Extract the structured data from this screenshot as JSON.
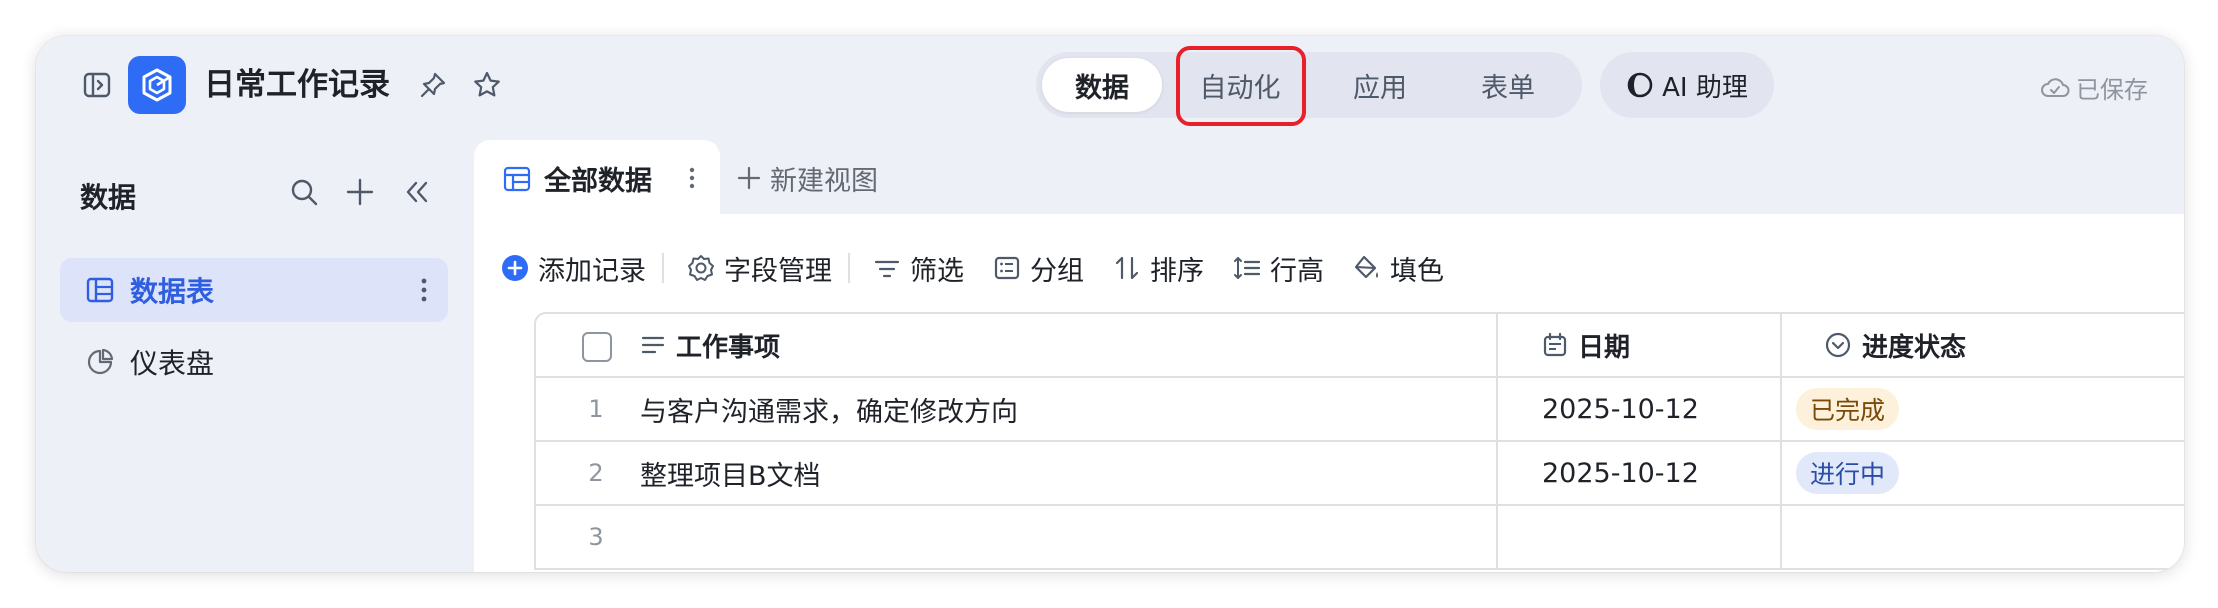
{
  "header": {
    "app_title": "日常工作记录",
    "tabs": [
      {
        "label": "数据",
        "active": true
      },
      {
        "label": "自动化",
        "active": false,
        "highlighted": true
      },
      {
        "label": "应用",
        "active": false
      },
      {
        "label": "表单",
        "active": false
      }
    ],
    "ai_button_label": "AI 助理",
    "saved_status": "已保存",
    "accent_color": "#2f6cf6",
    "highlight_color": "#e8202a"
  },
  "sidebar": {
    "title": "数据",
    "items": [
      {
        "label": "数据表",
        "icon": "table-icon",
        "active": true
      },
      {
        "label": "仪表盘",
        "icon": "dashboard-icon",
        "active": false
      }
    ]
  },
  "views": {
    "active_view": "全部数据",
    "new_view_label": "新建视图"
  },
  "toolbar": {
    "add_record": "添加记录",
    "field_manage": "字段管理",
    "filter": "筛选",
    "group": "分组",
    "sort": "排序",
    "row_height": "行高",
    "fill_color": "填色"
  },
  "table": {
    "columns": [
      {
        "label": "工作事项",
        "icon": "text-field-icon"
      },
      {
        "label": "日期",
        "icon": "date-field-icon"
      },
      {
        "label": "进度状态",
        "icon": "single-select-icon"
      }
    ],
    "rows": [
      {
        "num": "1",
        "task": "与客户沟通需求，确定修改方向",
        "date": "2025-10-12",
        "status": "已完成",
        "status_kind": "done"
      },
      {
        "num": "2",
        "task": "整理项目B文档",
        "date": "2025-10-12",
        "status": "进行中",
        "status_kind": "progress"
      },
      {
        "num": "3",
        "task": "",
        "date": "",
        "status": "",
        "status_kind": ""
      }
    ]
  }
}
